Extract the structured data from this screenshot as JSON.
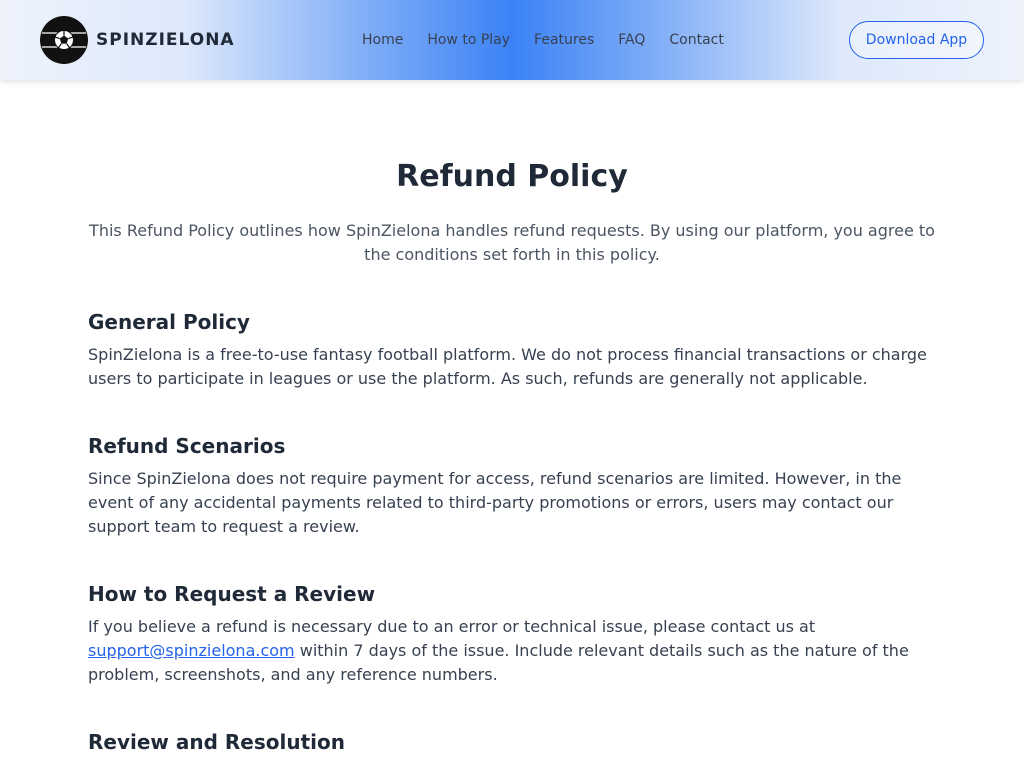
{
  "header": {
    "brand": "SPINZIELONA",
    "logo_icon": "soccer-ball-icon",
    "nav": [
      "Home",
      "How to Play",
      "Features",
      "FAQ",
      "Contact"
    ],
    "cta": "Download App"
  },
  "main": {
    "title": "Refund Policy",
    "intro": "This Refund Policy outlines how SpinZielona handles refund requests. By using our platform, you agree to the conditions set forth in this policy.",
    "sections": [
      {
        "title": "General Policy",
        "body": "SpinZielona is a free-to-use fantasy football platform. We do not process financial transactions or charge users to participate in leagues or use the platform. As such, refunds are generally not applicable."
      },
      {
        "title": "Refund Scenarios",
        "body": "Since SpinZielona does not require payment for access, refund scenarios are limited. However, in the event of any accidental payments related to third-party promotions or errors, users may contact our support team to request a review."
      },
      {
        "title": "How to Request a Review",
        "body_before": "If you believe a refund is necessary due to an error or technical issue, please contact us at ",
        "email": "support@spinzielona.com",
        "body_after": " within 7 days of the issue. Include relevant details such as the nature of the problem, screenshots, and any reference numbers."
      },
      {
        "title": "Review and Resolution"
      }
    ]
  },
  "colors": {
    "accent": "#2563eb",
    "header_gradient_center": "#3b82f6",
    "text": "#1f2937"
  }
}
